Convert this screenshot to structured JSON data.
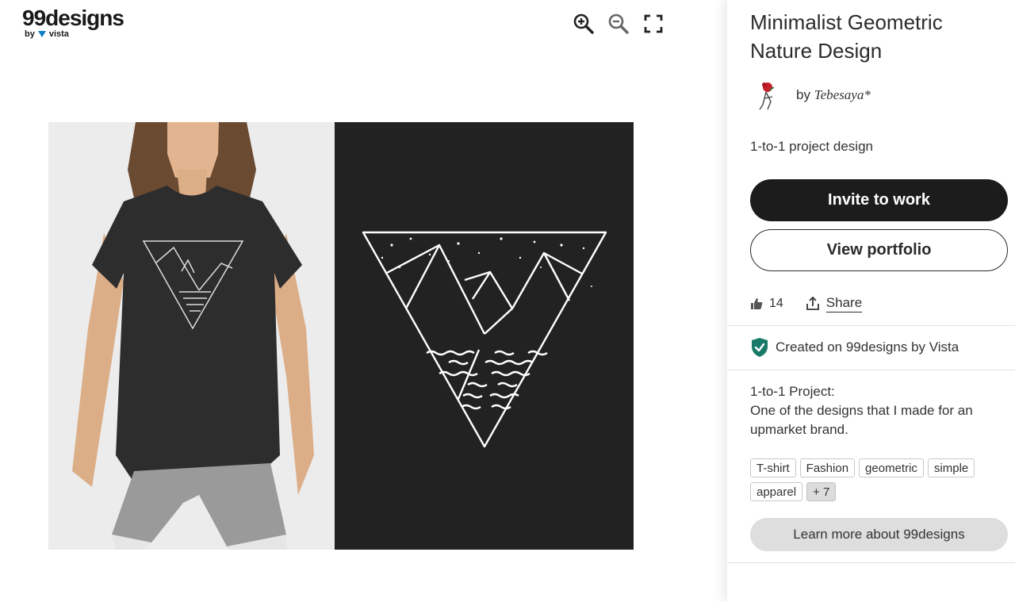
{
  "logo": {
    "main": "99designs",
    "sub": "by",
    "brand": "vista"
  },
  "toolbar": {
    "icons": [
      "zoom-in-icon",
      "zoom-out-icon",
      "fullscreen-icon"
    ]
  },
  "design": {
    "title": "Minimalist Geometric Nature Design",
    "designer_prefix": "by",
    "designer_name": "Tebesaya*",
    "project_type": "1-to-1 project design"
  },
  "buttons": {
    "invite": "Invite to work",
    "portfolio": "View portfolio",
    "learn_more": "Learn more about 99designs"
  },
  "stats": {
    "likes": "14",
    "share_label": "Share"
  },
  "created_on": "Created on 99designs by Vista",
  "description": {
    "heading": "1-to-1 Project:",
    "body": "One of the designs that I made for an upmarket brand."
  },
  "tags": [
    "T-shirt",
    "Fashion",
    "geometric",
    "simple",
    "apparel"
  ],
  "tags_more": "+ 7",
  "colors": {
    "primary_button": "#1c1c1c",
    "shield": "#1a7a6a",
    "artwork_bg": "#222222"
  }
}
